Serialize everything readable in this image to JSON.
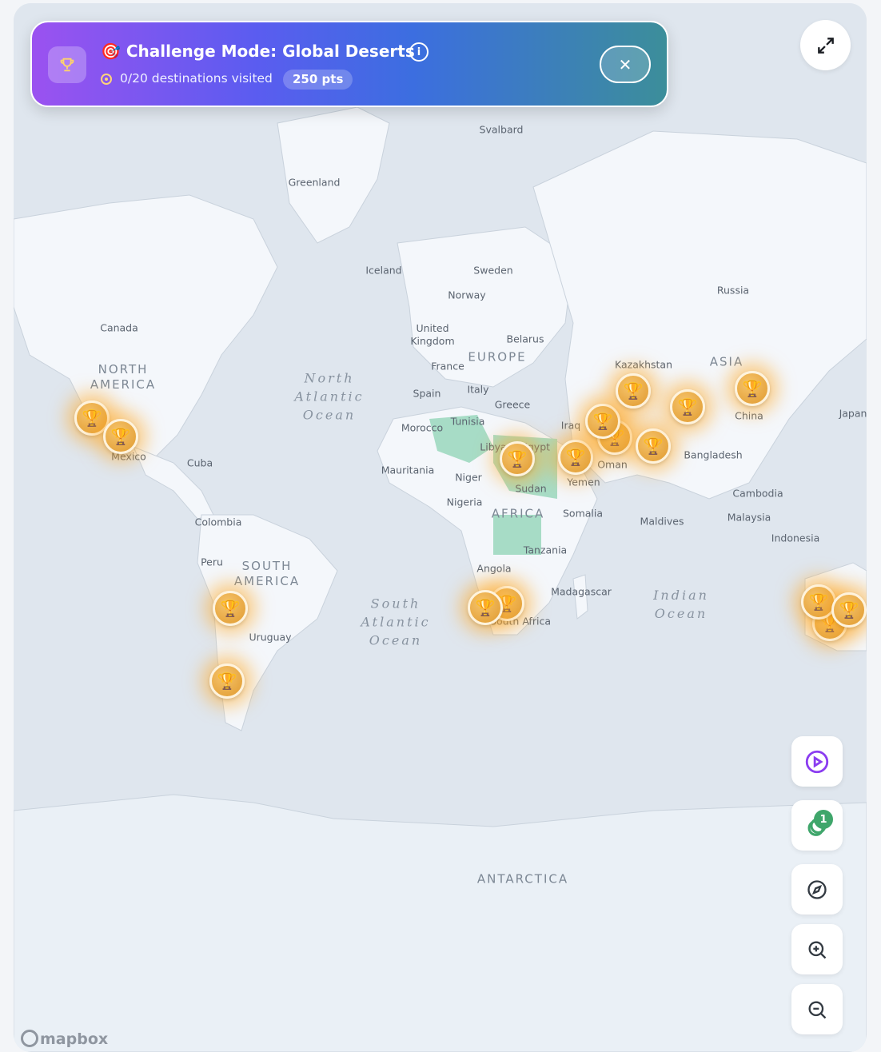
{
  "banner": {
    "title": "🎯 Challenge Mode: Global Deserts",
    "progress": "0/20 destinations visited",
    "points": "250 pts",
    "info_label": "i",
    "close_label": "✕"
  },
  "labels": {
    "countries": [
      "Svalbard",
      "Greenland",
      "Iceland",
      "Sweden",
      "Norway",
      "Russia",
      "Canada",
      "United Kingdom",
      "Belarus",
      "France",
      "Kazakhstan",
      "Spain",
      "Italy",
      "Greece",
      "Tunisia",
      "Morocco",
      "Libya",
      "Egypt",
      "Iraq",
      "Oman",
      "Yemen",
      "Sudan",
      "Mauritania",
      "Niger",
      "Nigeria",
      "Somalia",
      "Mexico",
      "Cuba",
      "Colombia",
      "Peru",
      "Uruguay",
      "Angola",
      "Tanzania",
      "Madagascar",
      "South Africa",
      "China",
      "Bangladesh",
      "Cambodia",
      "Malaysia",
      "Indonesia",
      "Maldives",
      "Japan"
    ],
    "regions": {
      "north_america": "NORTH AMERICA",
      "south_america": "SOUTH AMERICA",
      "europe": "EUROPE",
      "africa": "AFRICA",
      "asia": "ASIA",
      "antarctica": "ANTARCTICA"
    },
    "oceans": {
      "north_atlantic": "North Atlantic Ocean",
      "south_atlantic": "South Atlantic Ocean",
      "indian": "Indian Ocean"
    }
  },
  "controls": {
    "layers_badge": "1"
  },
  "attribution": "mapbox",
  "icons": {
    "trophy": "🏆",
    "play": "play-circle-icon",
    "layers": "layers-icon",
    "compass": "compass-icon",
    "zoom_in": "zoom-in-icon",
    "zoom_out": "zoom-out-icon",
    "expand": "expand-icon"
  },
  "colors": {
    "land": "#f4f7fb",
    "water": "#dfe6ee",
    "highlight_country": "#a7dcc6",
    "marker": "#e8a640",
    "accent_purple": "#8b3df0",
    "accent_green": "#3fa66b"
  }
}
